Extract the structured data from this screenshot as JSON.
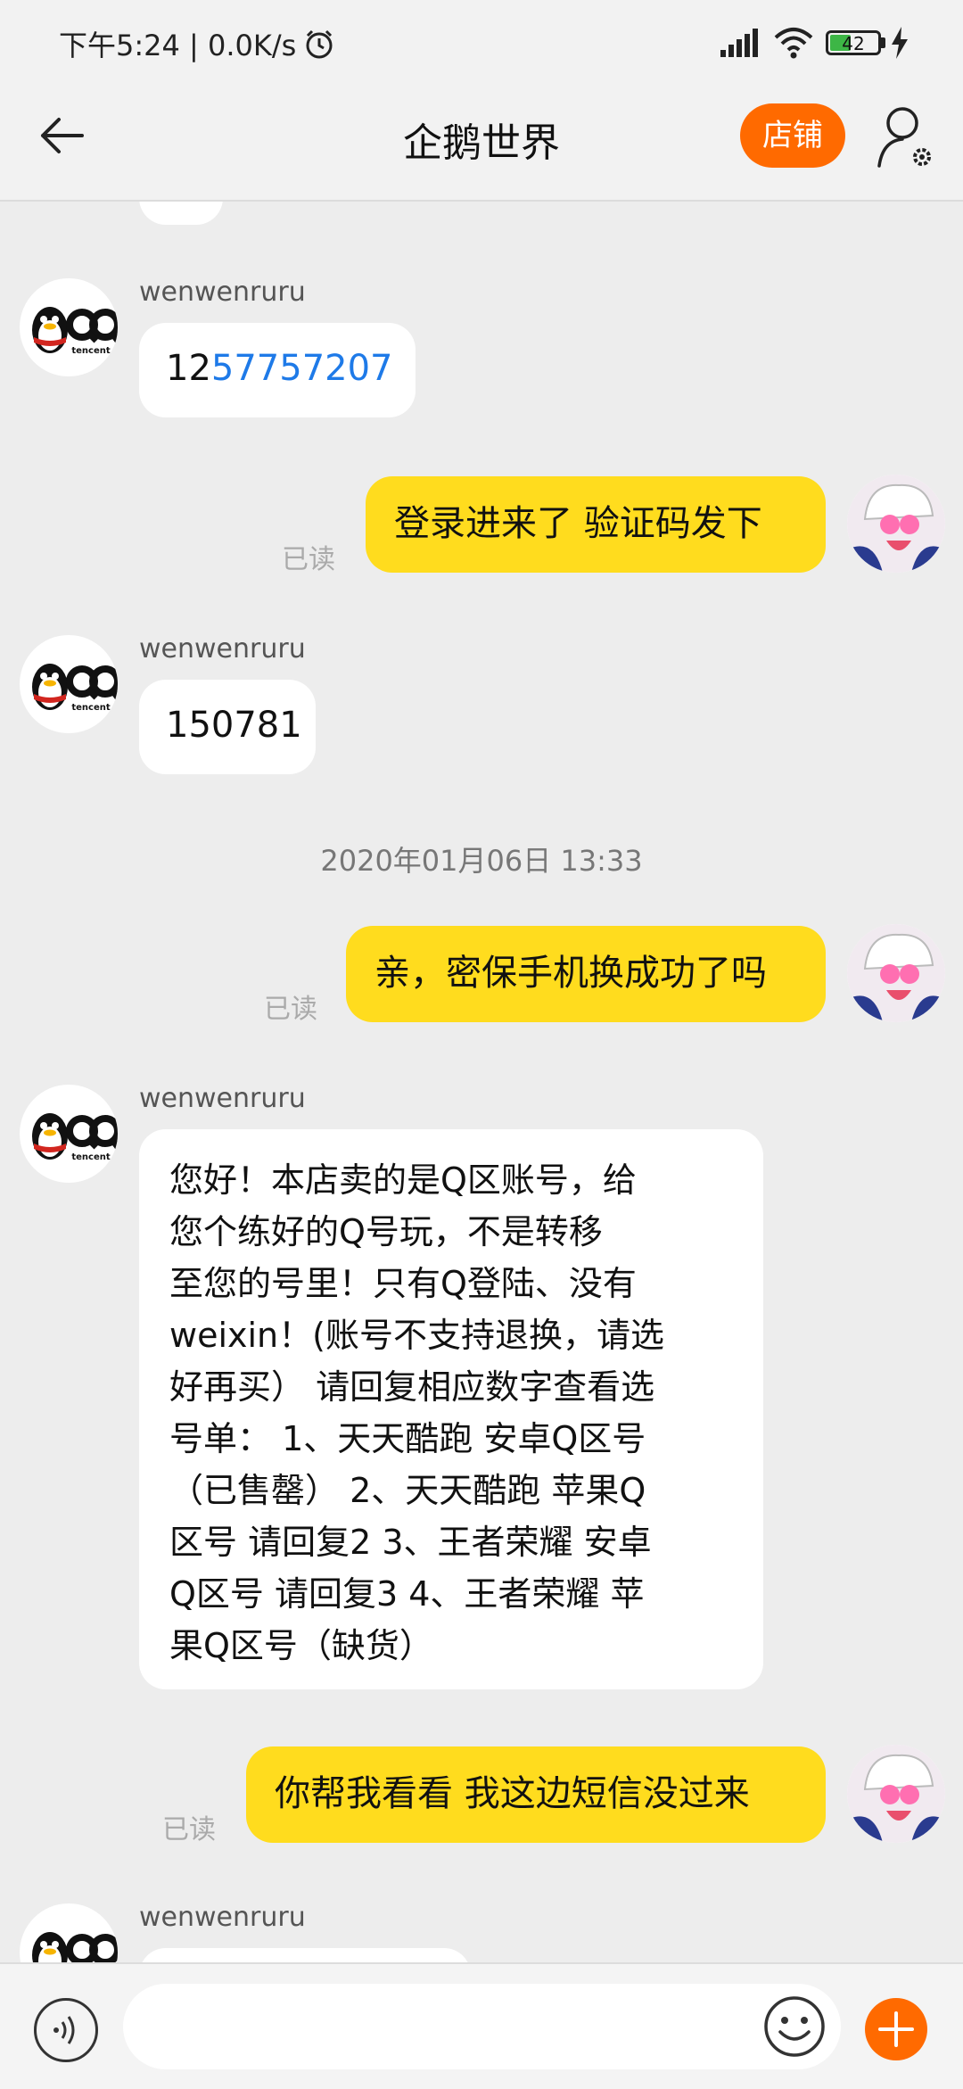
{
  "status_bar": {
    "time": "下午5:24 | 0.0K/s",
    "battery": "42"
  },
  "header": {
    "title": "企鹅世界",
    "shop_label": "店铺"
  },
  "messages": [
    {
      "side": "left",
      "sender": "wenwenruru",
      "text_plain": "12",
      "text_link": "57757207"
    },
    {
      "side": "right",
      "text": "登录进来了 验证码发下",
      "read": "已读"
    },
    {
      "side": "left",
      "sender": "wenwenruru",
      "text": "150781"
    },
    {
      "type": "timestamp",
      "text": "2020年01月06日 13:33"
    },
    {
      "side": "right",
      "text": "亲，密保手机换成功了吗",
      "read": "已读"
    },
    {
      "side": "left",
      "sender": "wenwenruru",
      "lines": [
        "您好！本店卖的是Q区账号，给",
        "您个练好的Q号玩，不是转移",
        "至您的号里！只有Q登陆、没有",
        "weixin！(账号不支持退换，请选",
        "好再买）  请回复相应数字查看选",
        "号单：  1、天天酷跑 安卓Q区号",
        "（已售罄）  2、天天酷跑 苹果Q",
        "区号 请回复2  3、王者荣耀 安卓",
        "Q区号 请回复3  4、王者荣耀 苹",
        "果Q区号（缺货）"
      ]
    },
    {
      "side": "right",
      "text": "你帮我看看 我这边短信没过来",
      "read": "已读"
    },
    {
      "side": "left",
      "sender": "wenwenruru"
    }
  ],
  "avatar_text": "tencent",
  "colors": {
    "accent": "#ff6a00",
    "own_bubble": "#ffdc1e",
    "link": "#1e7ae8"
  }
}
